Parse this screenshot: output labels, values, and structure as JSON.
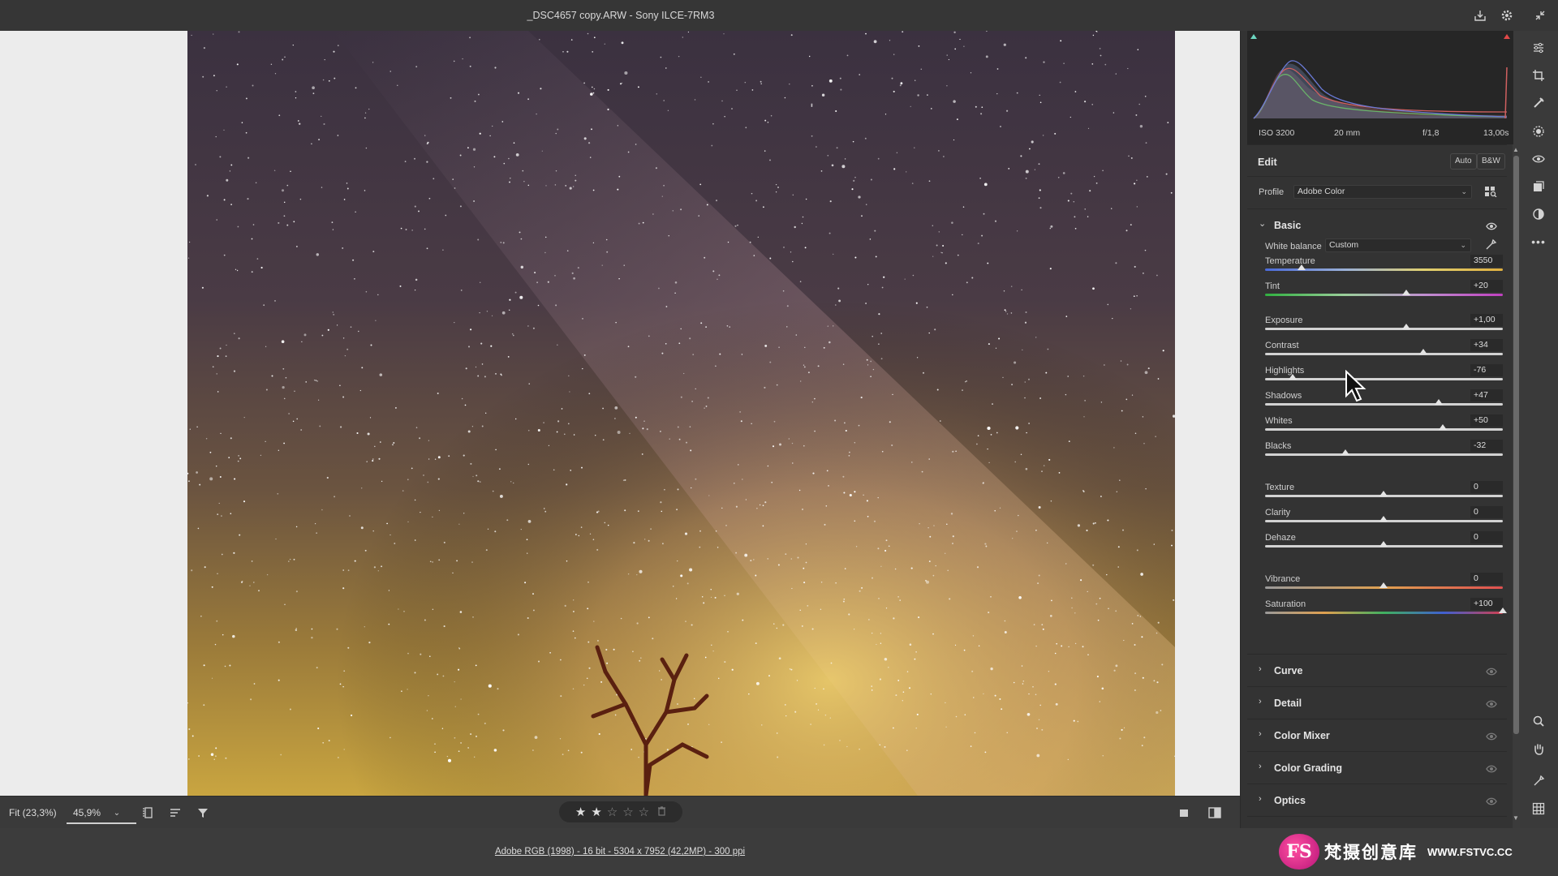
{
  "window": {
    "title": "_DSC4657 copy.ARW  -  Sony ILCE-7RM3"
  },
  "histogram": {
    "iso": "ISO 3200",
    "focal_length": "20 mm",
    "aperture": "f/1,8",
    "shutter": "13,00s"
  },
  "edit": {
    "title": "Edit",
    "auto_label": "Auto",
    "bw_label": "B&W",
    "profile_label": "Profile",
    "profile_value": "Adobe Color"
  },
  "basic": {
    "title": "Basic",
    "white_balance_label": "White balance",
    "white_balance_value": "Custom",
    "sliders": [
      {
        "label": "Temperature",
        "value": "3550",
        "position": 0.155
      },
      {
        "label": "Tint",
        "value": "+20",
        "position": 0.595
      },
      {
        "label": "Exposure",
        "value": "+1,00",
        "position": 0.595
      },
      {
        "label": "Contrast",
        "value": "+34",
        "position": 0.665
      },
      {
        "label": "Highlights",
        "value": "-76",
        "position": 0.115
      },
      {
        "label": "Shadows",
        "value": "+47",
        "position": 0.73
      },
      {
        "label": "Whites",
        "value": "+50",
        "position": 0.748
      },
      {
        "label": "Blacks",
        "value": "-32",
        "position": 0.337
      },
      {
        "label": "Texture",
        "value": "0",
        "position": 0.497
      },
      {
        "label": "Clarity",
        "value": "0",
        "position": 0.497
      },
      {
        "label": "Dehaze",
        "value": "0",
        "position": 0.497
      },
      {
        "label": "Vibrance",
        "value": "0",
        "position": 0.497
      },
      {
        "label": "Saturation",
        "value": "+100",
        "position": 1.0
      }
    ]
  },
  "sections": [
    {
      "title": "Curve"
    },
    {
      "title": "Detail"
    },
    {
      "title": "Color Mixer"
    },
    {
      "title": "Color Grading"
    },
    {
      "title": "Optics"
    }
  ],
  "bottombar": {
    "fit_label": "Fit (23,3%)",
    "zoom_value": "45,9%",
    "rating_stars_filled": 2,
    "rating_stars_total": 5
  },
  "status": {
    "file_info": "Adobe RGB (1998) - 16 bit - 5304 x 7952 (42,2MP) - 300 ppi"
  },
  "watermark": {
    "logo": "FS",
    "name_cn": "梵摄创意库",
    "url": "WWW.FSTVC.CC"
  },
  "colors": {
    "panel_bg": "#333333",
    "canvas_bg": "#ececec",
    "accent_pink": "#d0187c"
  }
}
